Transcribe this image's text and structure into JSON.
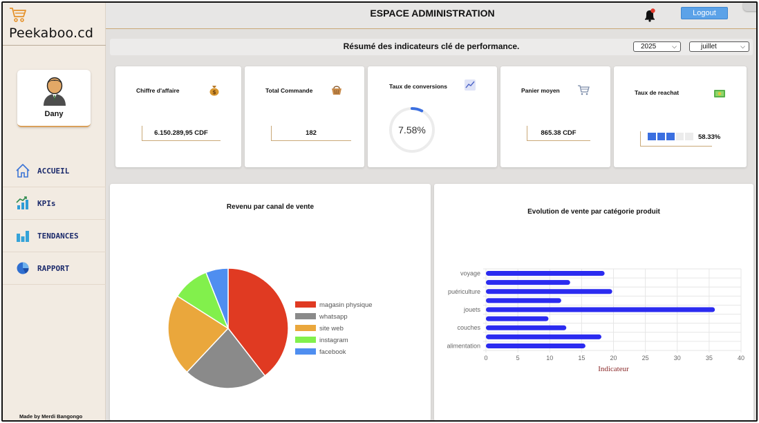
{
  "app": {
    "brand": "Peekaboo.cd",
    "header_title": "ESPACE ADMINISTRATION",
    "logout_label": "Logout"
  },
  "profile": {
    "name": "Dany"
  },
  "nav": [
    {
      "label": "ACCUEIL",
      "icon": "home-icon"
    },
    {
      "label": "KPIs",
      "icon": "kpi-chart-icon"
    },
    {
      "label": "TENDANCES",
      "icon": "bar-chart-icon"
    },
    {
      "label": "RAPPORT",
      "icon": "pie-chart-icon"
    }
  ],
  "footer": {
    "made_by": "Made by Merdi Bangongo"
  },
  "summary": {
    "title": "Résumé des indicateurs clé de performance.",
    "year": "2025",
    "month": "juillet"
  },
  "kpis": {
    "chiffre": {
      "title": "Chiffre d'affaire",
      "value": "6.150.289,95 CDF",
      "icon": "money-bag-icon"
    },
    "commande": {
      "title": "Total Commande",
      "value": "182",
      "icon": "basket-icon"
    },
    "conversion": {
      "title": "Taux de conversions",
      "value": "7.58%",
      "percent": 7.58,
      "icon": "trend-chart-icon"
    },
    "panier": {
      "title": "Panier moyen",
      "value": "865.38 CDF",
      "icon": "cart-icon"
    },
    "reachat": {
      "title": "Taux de reachat",
      "value": "58.33%",
      "percent": 58.33,
      "segments_filled": 3,
      "segments_total": 5,
      "icon": "cash-icon"
    }
  },
  "colors": {
    "accent": "#c9a877",
    "primary_blue": "#3b6fe0",
    "bar_blue": "#2b2bf0",
    "nav_text": "#1b2a6b"
  },
  "chart_data": [
    {
      "type": "pie",
      "title": "Revenu par canal de vente",
      "legend_position": "right",
      "slices": [
        {
          "label": "magasin physique",
          "value": 39.5,
          "color": "#e03a22"
        },
        {
          "label": "whatsapp",
          "value": 22.5,
          "color": "#8a8a8a"
        },
        {
          "label": "site web",
          "value": 22.0,
          "color": "#eaa73c"
        },
        {
          "label": "instagram",
          "value": 10.0,
          "color": "#82f04c"
        },
        {
          "label": "facebook",
          "value": 6.0,
          "color": "#4f8ef0"
        }
      ]
    },
    {
      "type": "bar",
      "orientation": "horizontal",
      "title": "Evolution de vente par catégorie produit",
      "xlabel": "Indicateur",
      "xlim": [
        0,
        40
      ],
      "xticks": [
        0,
        5,
        10,
        15,
        20,
        25,
        30,
        35,
        40
      ],
      "grid": true,
      "categories": [
        "voyage",
        "",
        "puériculture",
        "",
        "jouets",
        "",
        "couches",
        "",
        "alimentation"
      ],
      "values": [
        18.6,
        13.2,
        19.8,
        11.8,
        35.9,
        9.8,
        12.6,
        18.1,
        15.6
      ],
      "color": "#2b2bf0"
    }
  ]
}
